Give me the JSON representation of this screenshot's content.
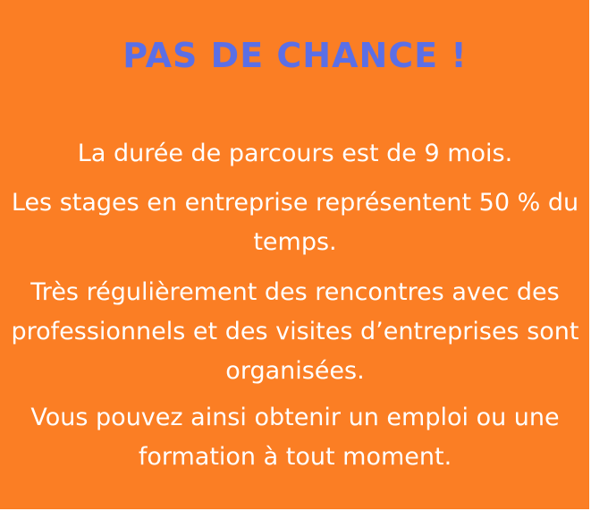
{
  "panel": {
    "background_color": "#fb7e24",
    "title": "PAS DE CHANCE !",
    "title_color": "#5b6fe6",
    "paragraphs": [
      "La durée de parcours est de 9 mois.",
      "Les stages en entreprise représentent 50 % du temps.",
      "Très régulièrement des rencontres avec des professionnels et des visites d’entreprises sont organisées.",
      "Vous pouvez ainsi obtenir un emploi ou une formation à tout moment."
    ],
    "text_color": "#ffffff"
  }
}
